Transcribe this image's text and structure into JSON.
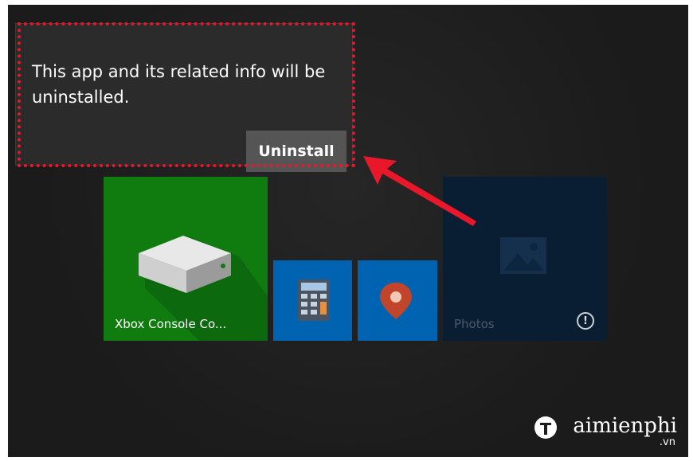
{
  "flyout": {
    "message": "This app and its related info will be uninstalled.",
    "uninstall_label": "Uninstall",
    "highlight_color": "#e8172a"
  },
  "tiles": {
    "xbox": {
      "label": "Xbox Console Co...",
      "color": "#107c10",
      "icon": "xbox-console-icon"
    },
    "calculator": {
      "color": "#0063b1",
      "icon": "calculator-icon"
    },
    "maps": {
      "color": "#0063b1",
      "icon": "map-pin-icon"
    },
    "photos": {
      "label": "Photos",
      "icon": "photo-icon",
      "badge_icon": "warning-icon",
      "badge_text": "!"
    }
  },
  "watermark": {
    "text": "aimienphi",
    "suffix": ".vn",
    "logo_icon": "taimienphi-logo"
  },
  "annotation": {
    "arrow_color": "#e8172a",
    "icon": "red-arrow-icon"
  }
}
